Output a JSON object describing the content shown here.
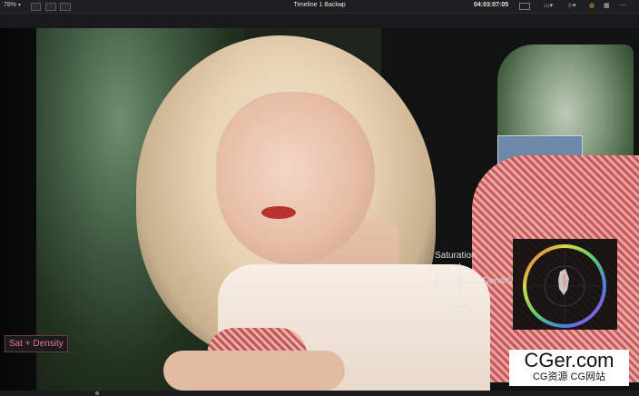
{
  "toolbar": {
    "zoom": "78%",
    "timeline_title": "Timeline 1 Backup",
    "timecode": "04:03:07:05",
    "icons": [
      "viewer-layout-icon",
      "single-viewer-icon",
      "dual-viewer-icon",
      "title-dropdown-icon",
      "monitor-icon",
      "clip-icon",
      "transform-icon",
      "color-wheel-icon",
      "more-icon"
    ]
  },
  "overlay": {
    "saturation_label": "Saturation",
    "density_label": "Density",
    "badge_label": "Sat + Density"
  },
  "watermark": {
    "title": "CGer.com",
    "subtitle": "CG资源 CG网站"
  },
  "colors": {
    "badge_border": "#6d3a4a",
    "badge_text": "#e6789a",
    "timecode_bg": "#1f1f21"
  }
}
